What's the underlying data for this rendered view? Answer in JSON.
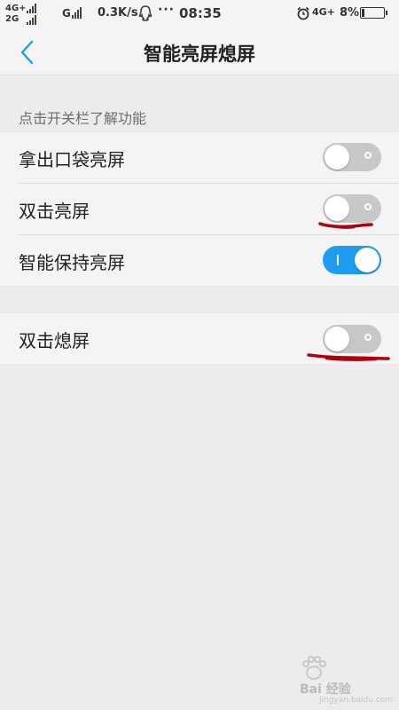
{
  "status_bar": {
    "network1": "4G+",
    "network2": "2G",
    "network3": "G",
    "speed": "0.3K/s",
    "dots": "···",
    "time": "08:35",
    "network4": "4G+",
    "battery": "8%"
  },
  "header": {
    "title": "智能亮屏熄屏",
    "back_icon": "chevron-left-icon",
    "accent_color": "#1e9cf0"
  },
  "hint": "点击开关栏了解功能",
  "settings": [
    {
      "label": "拿出口袋亮屏",
      "enabled": false
    },
    {
      "label": "双击亮屏",
      "enabled": false
    },
    {
      "label": "智能保持亮屏",
      "enabled": true
    }
  ],
  "settings2": [
    {
      "label": "双击熄屏",
      "enabled": false
    }
  ],
  "watermark": {
    "text": "Bai 经验",
    "sub": "jingyan.baidu.com"
  }
}
